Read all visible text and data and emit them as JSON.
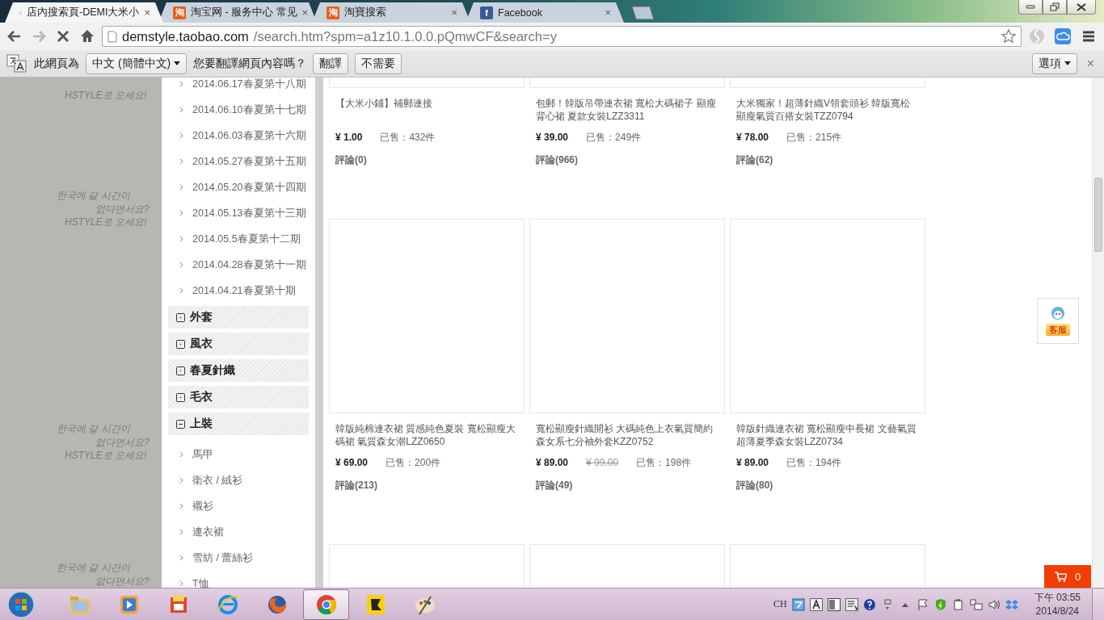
{
  "browser": {
    "tabs": [
      {
        "title": "店內搜索頁-DEMI大米小",
        "kind": "loading",
        "close": "×",
        "selected": true
      },
      {
        "title": "淘宝网 - 服务中心 常见",
        "kind": "site",
        "icon_text": "淘",
        "color": "#e8601c",
        "close": "×",
        "selected": false
      },
      {
        "title": "淘寶搜索",
        "kind": "site",
        "icon_text": "淘",
        "color": "#e8601c",
        "close": "×",
        "selected": false
      },
      {
        "title": "Facebook",
        "kind": "site",
        "icon_text": "f",
        "color": "#3b5998",
        "close": "×",
        "selected": false
      }
    ],
    "address": {
      "host": "demstyle.taobao.com",
      "path": "/search.htm?spm=a1z10.1.0.0.pQmwCF&search=y"
    }
  },
  "translate_bar": {
    "lead": "此網頁為",
    "language": "中文 (簡體中文)",
    "question": "您要翻譯網頁內容嗎？",
    "buttons": [
      "翻譯",
      "不需要"
    ],
    "options": "選項",
    "close": "×"
  },
  "background_slogans": [
    [
      "HSTYLE로 오세요!"
    ],
    [
      "한국에 갈 시간이",
      "없다면서요?",
      "HSTYLE로 오세요!"
    ],
    [
      "한국에 갈 시간이",
      "없다면서요?",
      "HSTYLE로 오세요!"
    ],
    [
      "한국에 갈 시간이",
      "없다면서요?"
    ]
  ],
  "sidebar": {
    "issues": [
      "2014.06.17春夏第十八期",
      "2014.06.10春夏第十七期",
      "2014.06.03春夏第十六期",
      "2014.05.27春夏第十五期",
      "2014.05.20春夏第十四期",
      "2014.05.13春夏第十三期",
      "2014.05.5春夏第十二期",
      "2014.04.28春夏第十一期",
      "2014.04.21春夏第十期"
    ],
    "categories": [
      {
        "label": "外套",
        "expanded": false
      },
      {
        "label": "風衣",
        "expanded": false
      },
      {
        "label": "春夏針織",
        "expanded": false
      },
      {
        "label": "毛衣",
        "expanded": false
      },
      {
        "label": "上裝",
        "expanded": true,
        "children": [
          {
            "label": "馬甲"
          },
          {
            "label": "衛衣 / 絨衫"
          },
          {
            "label": "襯衫"
          },
          {
            "label": "連衣裙"
          },
          {
            "label": "雪紡 / 蕾絲衫"
          },
          {
            "label": "T恤"
          }
        ]
      }
    ]
  },
  "products": [
    {
      "title": "【大米小鋪】補郵連接",
      "price": "¥ 1.00",
      "sold": "已售：432件",
      "reviews": "評論(0)"
    },
    {
      "title": "包郵！韓版吊帶連衣裙 寬松大碼裙子 顯瘦背心裙 夏款女裝LZZ3311",
      "price": "¥ 39.00",
      "sold": "已售：249件",
      "reviews": "評論(966)"
    },
    {
      "title": "大米獨家！超薄針織V領套頭衫 韓版寬松顯瘦氣質百搭女裝TZZ0794",
      "price": "¥ 78.00",
      "sold": "已售：215件",
      "reviews": "評論(62)"
    },
    {
      "title": "韓版純棉連衣裙 質感純色夏裝 寬松顯瘦大碼裙 氣質森女潮LZZ0650",
      "price": "¥ 69.00",
      "sold": "已售：200件",
      "reviews": "評論(213)"
    },
    {
      "title": "寬松顯瘦針織開衫 大碼純色上衣氣質簡約森女系七分袖外套KZZ0752",
      "price": "¥ 89.00",
      "original_price": "¥ 99.00",
      "sold": "已售：198件",
      "reviews": "評論(49)"
    },
    {
      "title": "韓版針織連衣裙 寬松顯瘦中長裙 文藝氣質超薄夏季森女裝LZZ0734",
      "price": "¥ 89.00",
      "sold": "已售：194件",
      "reviews": "評論(80)"
    }
  ],
  "service_widget": {
    "label": "客服"
  },
  "cart": {
    "count": "0"
  },
  "taskbar": {
    "pinned": [
      {
        "kind": "folder",
        "active": false
      },
      {
        "kind": "media",
        "active": false
      },
      {
        "kind": "office",
        "active": false
      },
      {
        "kind": "ie",
        "active": false
      },
      {
        "kind": "firefox",
        "active": false
      },
      {
        "kind": "chrome",
        "active": true
      },
      {
        "kind": "yellow",
        "active": false
      },
      {
        "kind": "paint",
        "active": false
      }
    ],
    "ime": "CH",
    "time": "下午 03:55",
    "date": "2014/8/24"
  }
}
